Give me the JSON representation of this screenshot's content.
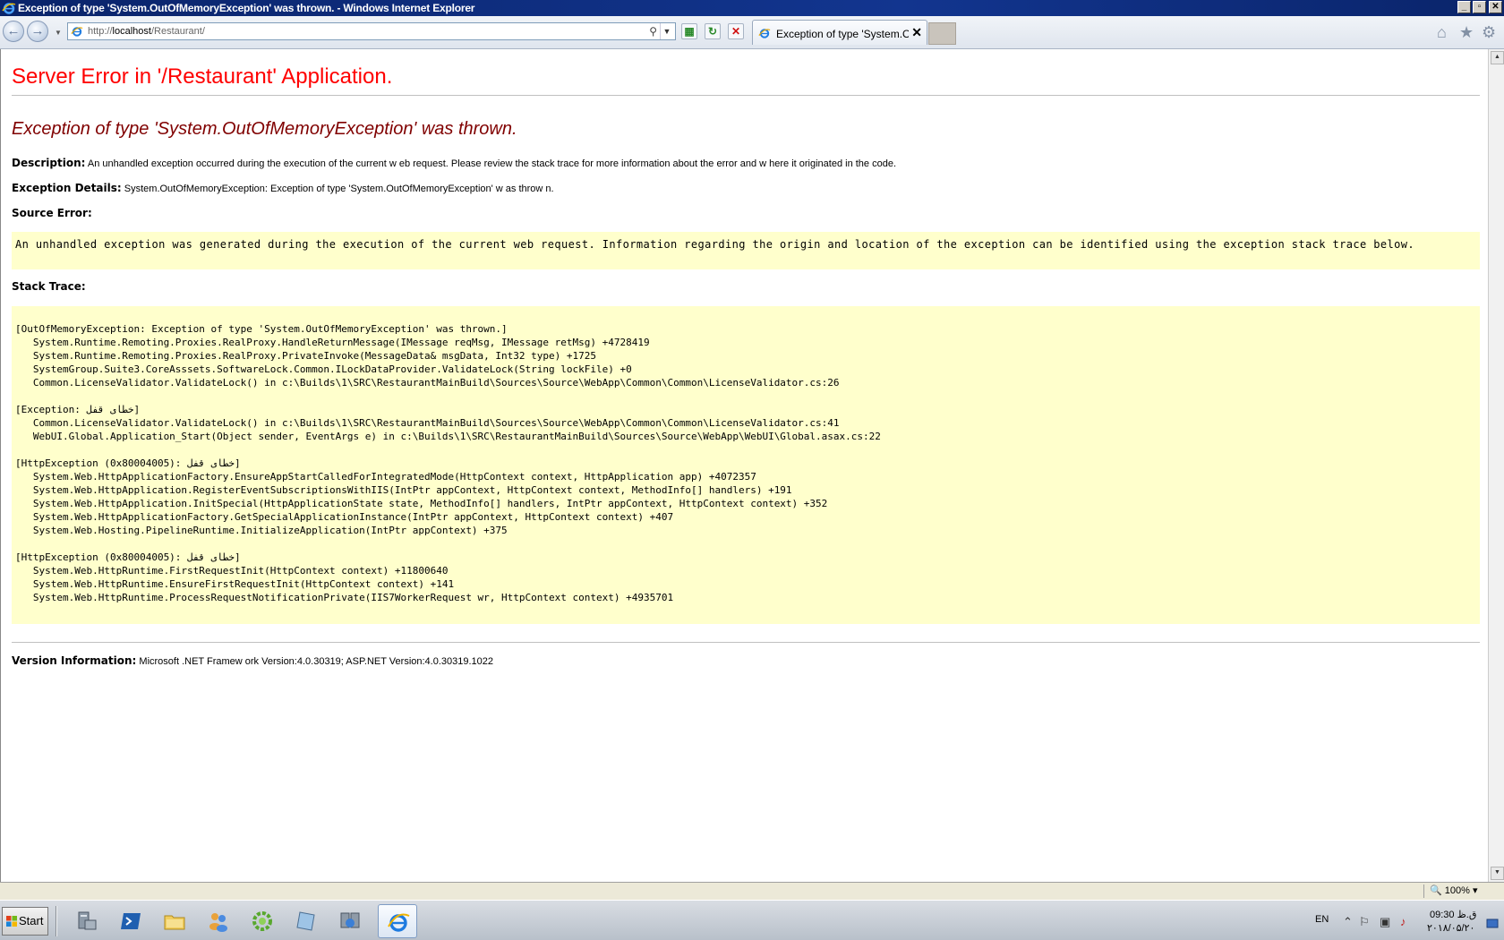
{
  "window": {
    "title": "Exception of type 'System.OutOfMemoryException' was thrown. - Windows Internet Explorer"
  },
  "navbar": {
    "url_prefix": "http://",
    "url_host": "localhost",
    "url_path": "/Restaurant/",
    "tab_label": "Exception of type 'System.O...",
    "tab_close": "✕"
  },
  "page": {
    "heading": "Server Error in '/Restaurant' Application.",
    "exception_title": "Exception of type 'System.OutOfMemoryException' was thrown.",
    "description_label": "Description:",
    "description_text": "An unhandled exception occurred during the execution of the current w eb request. Please review  the stack trace for more information about the error and w here it originated in the code.",
    "details_label": "Exception Details:",
    "details_text": "System.OutOfMemoryException: Exception of type 'System.OutOfMemoryException' w as throw n.",
    "source_error_label": "Source Error:",
    "source_error_text": "An unhandled exception was generated during the execution of the current web request. Information regarding the origin and location of the exception can be identified using the exception stack trace below.",
    "stack_trace_label": "Stack Trace:",
    "stack_trace_lines": [
      "[OutOfMemoryException: Exception of type 'System.OutOfMemoryException' was thrown.]",
      "   System.Runtime.Remoting.Proxies.RealProxy.HandleReturnMessage(IMessage reqMsg, IMessage retMsg) +4728419",
      "   System.Runtime.Remoting.Proxies.RealProxy.PrivateInvoke(MessageData& msgData, Int32 type) +1725",
      "   SystemGroup.Suite3.CoreAsssets.SoftwareLock.Common.ILockDataProvider.ValidateLock(String lockFile) +0",
      "   Common.LicenseValidator.ValidateLock() in c:\\Builds\\1\\SRC\\RestaurantMainBuild\\Sources\\Source\\WebApp\\Common\\Common\\LicenseValidator.cs:26",
      "",
      "[Exception: خطای قفل]",
      "   Common.LicenseValidator.ValidateLock() in c:\\Builds\\1\\SRC\\RestaurantMainBuild\\Sources\\Source\\WebApp\\Common\\Common\\LicenseValidator.cs:41",
      "   WebUI.Global.Application_Start(Object sender, EventArgs e) in c:\\Builds\\1\\SRC\\RestaurantMainBuild\\Sources\\Source\\WebApp\\WebUI\\Global.asax.cs:22",
      "",
      "[HttpException (0x80004005): خطای قفل]",
      "   System.Web.HttpApplicationFactory.EnsureAppStartCalledForIntegratedMode(HttpContext context, HttpApplication app) +4072357",
      "   System.Web.HttpApplication.RegisterEventSubscriptionsWithIIS(IntPtr appContext, HttpContext context, MethodInfo[] handlers) +191",
      "   System.Web.HttpApplication.InitSpecial(HttpApplicationState state, MethodInfo[] handlers, IntPtr appContext, HttpContext context) +352",
      "   System.Web.HttpApplicationFactory.GetSpecialApplicationInstance(IntPtr appContext, HttpContext context) +407",
      "   System.Web.Hosting.PipelineRuntime.InitializeApplication(IntPtr appContext) +375",
      "",
      "[HttpException (0x80004005): خطای قفل]",
      "   System.Web.HttpRuntime.FirstRequestInit(HttpContext context) +11800640",
      "   System.Web.HttpRuntime.EnsureFirstRequestInit(HttpContext context) +141",
      "   System.Web.HttpRuntime.ProcessRequestNotificationPrivate(IIS7WorkerRequest wr, HttpContext context) +4935701"
    ],
    "version_label": "Version Information:",
    "version_text": "Microsoft .NET Framew ork Version:4.0.30319; ASP.NET Version:4.0.30319.1022"
  },
  "statusbar": {
    "zoom": "100%"
  },
  "taskbar": {
    "start_label": "Start",
    "language": "EN",
    "clock_time": "09:30 ق.ظ",
    "clock_date": "۲۰۱۸/۰۵/۲۰"
  },
  "icons": {
    "back": "arrow-left-icon",
    "forward": "arrow-right-icon",
    "search": "search-icon",
    "home": "home-icon",
    "favorites": "star-icon",
    "tools": "gear-icon"
  },
  "colors": {
    "error_heading": "#ff0000",
    "exception_title": "#800000",
    "code_background": "#ffffcc"
  }
}
